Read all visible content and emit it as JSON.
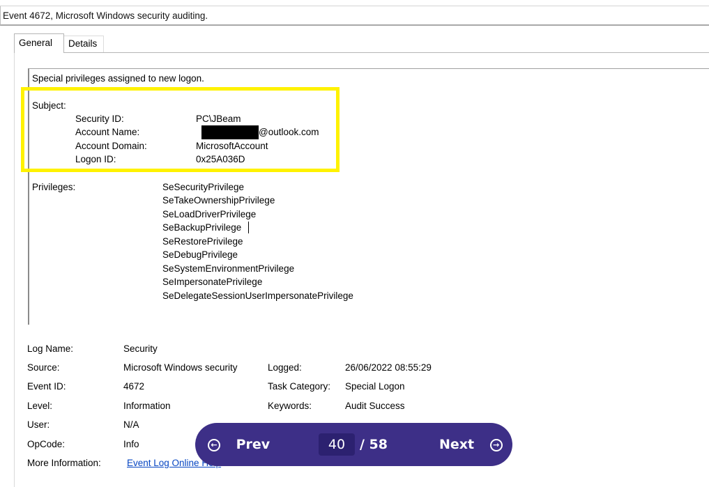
{
  "window": {
    "title": "Event 4672, Microsoft Windows security auditing."
  },
  "tabs": [
    {
      "label": "General"
    },
    {
      "label": "Details"
    }
  ],
  "description": {
    "summary": "Special privileges assigned to new logon.",
    "subject_label": "Subject:",
    "subject": [
      {
        "label": "Security ID:",
        "value": "PC\\JBeam"
      },
      {
        "label": "Account Name:",
        "value": "@outlook.com"
      },
      {
        "label": "Account Domain:",
        "value": "MicrosoftAccount"
      },
      {
        "label": "Logon ID:",
        "value": "0x25A036D"
      }
    ],
    "privileges_label": "Privileges:",
    "privileges": [
      "SeSecurityPrivilege",
      "SeTakeOwnershipPrivilege",
      "SeLoadDriverPrivilege",
      "SeBackupPrivilege",
      "SeRestorePrivilege",
      "SeDebugPrivilege",
      "SeSystemEnvironmentPrivilege",
      "SeImpersonatePrivilege",
      "SeDelegateSessionUserImpersonatePrivilege"
    ]
  },
  "details": {
    "log_name": {
      "label": "Log Name:",
      "value": "Security"
    },
    "source": {
      "label": "Source:",
      "value": "Microsoft Windows security"
    },
    "logged": {
      "label": "Logged:",
      "value": "26/06/2022 08:55:29"
    },
    "event_id": {
      "label": "Event ID:",
      "value": "4672"
    },
    "task_category": {
      "label": "Task Category:",
      "value": "Special Logon"
    },
    "level": {
      "label": "Level:",
      "value": "Information"
    },
    "keywords": {
      "label": "Keywords:",
      "value": "Audit Success"
    },
    "user": {
      "label": "User:",
      "value": "N/A"
    },
    "opcode": {
      "label": "OpCode:",
      "value": "Info"
    },
    "more_info": {
      "label": "More Information:",
      "link": "Event Log Online Help"
    }
  },
  "pager": {
    "prev_label": "Prev",
    "next_label": "Next",
    "current_page": "40",
    "total_pages": "/ 58",
    "accent_color": "#3d2f87"
  },
  "highlight": {
    "color": "#fff200"
  }
}
